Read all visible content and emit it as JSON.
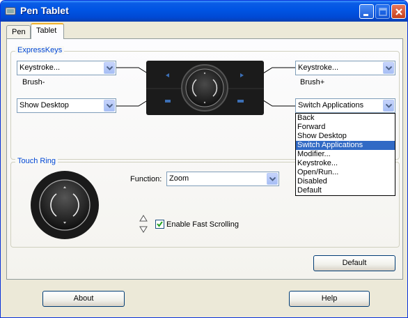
{
  "window": {
    "title": "Pen Tablet"
  },
  "tabs": [
    {
      "label": "Pen"
    },
    {
      "label": "Tablet"
    }
  ],
  "expresskeys": {
    "group_title": "ExpressKeys",
    "top_left": {
      "value": "Keystroke...",
      "caption": "Brush-"
    },
    "bottom_left": {
      "value": "Show Desktop"
    },
    "top_right": {
      "value": "Keystroke...",
      "caption": "Brush+"
    },
    "bottom_right": {
      "value": "Switch Applications"
    },
    "dropdown_options": [
      "Back",
      "Forward",
      "Show Desktop",
      "Switch Applications",
      "Modifier...",
      "Keystroke...",
      "Open/Run...",
      "Disabled",
      "Default"
    ],
    "dropdown_selected": "Switch Applications"
  },
  "touch_ring": {
    "group_title": "Touch Ring",
    "function_label": "Function:",
    "function_value": "Zoom",
    "fast_scrolling_label": "Enable Fast Scrolling",
    "fast_scrolling_checked": true
  },
  "buttons": {
    "default": "Default",
    "about": "About",
    "help": "Help"
  }
}
